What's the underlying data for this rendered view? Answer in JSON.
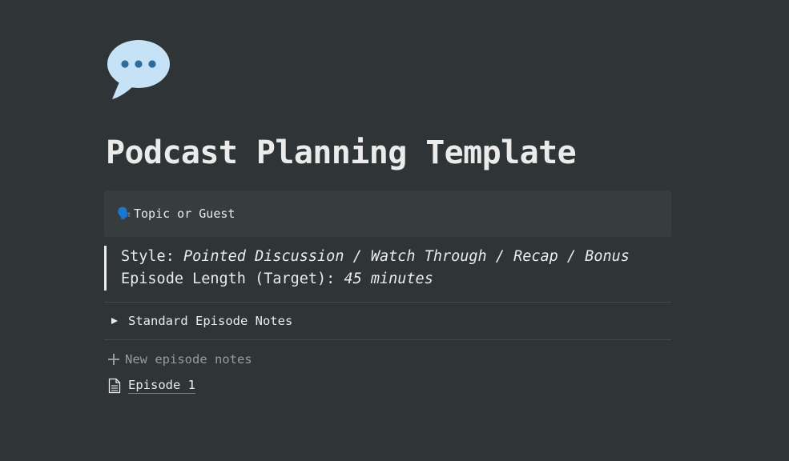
{
  "page": {
    "icon": "speech-balloon-icon",
    "title": "Podcast Planning Template"
  },
  "callout": {
    "emoji": "🗣️",
    "text": "Topic or Guest"
  },
  "quote": {
    "style_label": "Style: ",
    "style_value": "Pointed Discussion / Watch Through / Recap / Bonus",
    "length_label": "Episode Length (Target): ",
    "length_value": "45 minutes"
  },
  "toggle": {
    "icon": "triangle-right-icon",
    "label": "Standard Episode Notes"
  },
  "database": {
    "new_label": "New episode notes",
    "items": [
      {
        "icon": "document-icon",
        "label": "Episode 1"
      }
    ]
  },
  "colors": {
    "background": "#2f3437",
    "text": "#ebebea",
    "muted": "#9b9b99",
    "callout_bg": "#373c3f",
    "balloon": "#c6e2f7",
    "balloon_dots": "#2f6a99"
  }
}
